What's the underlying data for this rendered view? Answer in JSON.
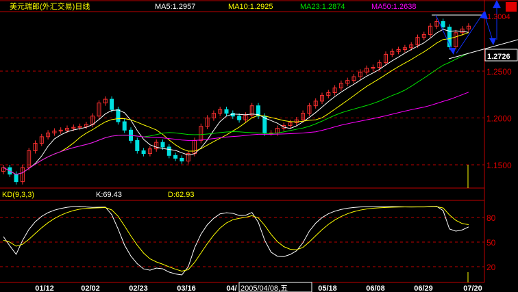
{
  "header": {
    "title": "美元瑞郎(外汇交易)日线",
    "ma5": "MA5:1.2957",
    "ma10": "MA10:1.2925",
    "ma23": "MA23:1.2874",
    "ma50": "MA50:1.2638"
  },
  "kd_header": {
    "title": "KD(9,3,3)",
    "k": "K:69.43",
    "d": "D:62.93"
  },
  "price_labels": {
    "high": "1.3004",
    "current": "1.2726"
  },
  "cursor_date": "2005/04/08,五",
  "colors": {
    "up": "#ff3030",
    "down": "#00e0e0",
    "ma5": "#ffffff",
    "ma10": "#ffff00",
    "ma23": "#00e000",
    "ma50": "#ff00ff",
    "grid": "#c00000",
    "arrow": "#1030ff"
  },
  "chart_data": {
    "type": "candlestick",
    "title": "美元瑞郎(外汇交易)日线",
    "yticks": [
      "1.2500",
      "1.2000",
      "1.1500"
    ],
    "ytick_values": [
      1.25,
      1.2,
      1.15
    ],
    "ylim": [
      1.12,
      1.315
    ],
    "kd_yticks": [
      "80",
      "50",
      "20"
    ],
    "kd_ytick_values": [
      80,
      50,
      20
    ],
    "xticks": [
      "01/12",
      "02/02",
      "02/23",
      "03/16",
      "04/",
      "05/18",
      "06/08",
      "06/29",
      "07/20"
    ],
    "close": [
      1.147,
      1.14,
      1.132,
      1.147,
      1.165,
      1.173,
      1.18,
      1.184,
      1.186,
      1.187,
      1.189,
      1.19,
      1.191,
      1.193,
      1.202,
      1.216,
      1.22,
      1.209,
      1.196,
      1.187,
      1.176,
      1.165,
      1.162,
      1.167,
      1.174,
      1.169,
      1.16,
      1.157,
      1.154,
      1.162,
      1.176,
      1.191,
      1.2,
      1.205,
      1.209,
      1.205,
      1.202,
      1.198,
      1.203,
      1.213,
      1.202,
      1.184,
      1.184,
      1.189,
      1.192,
      1.195,
      1.198,
      1.205,
      1.213,
      1.218,
      1.224,
      1.227,
      1.232,
      1.237,
      1.24,
      1.244,
      1.249,
      1.253,
      1.254,
      1.259,
      1.268,
      1.271,
      1.273,
      1.275,
      1.278,
      1.286,
      1.289,
      1.298,
      1.303,
      1.297,
      1.276,
      1.291,
      1.295,
      1.298
    ],
    "ma_periods": [
      5,
      10,
      23,
      50
    ]
  }
}
